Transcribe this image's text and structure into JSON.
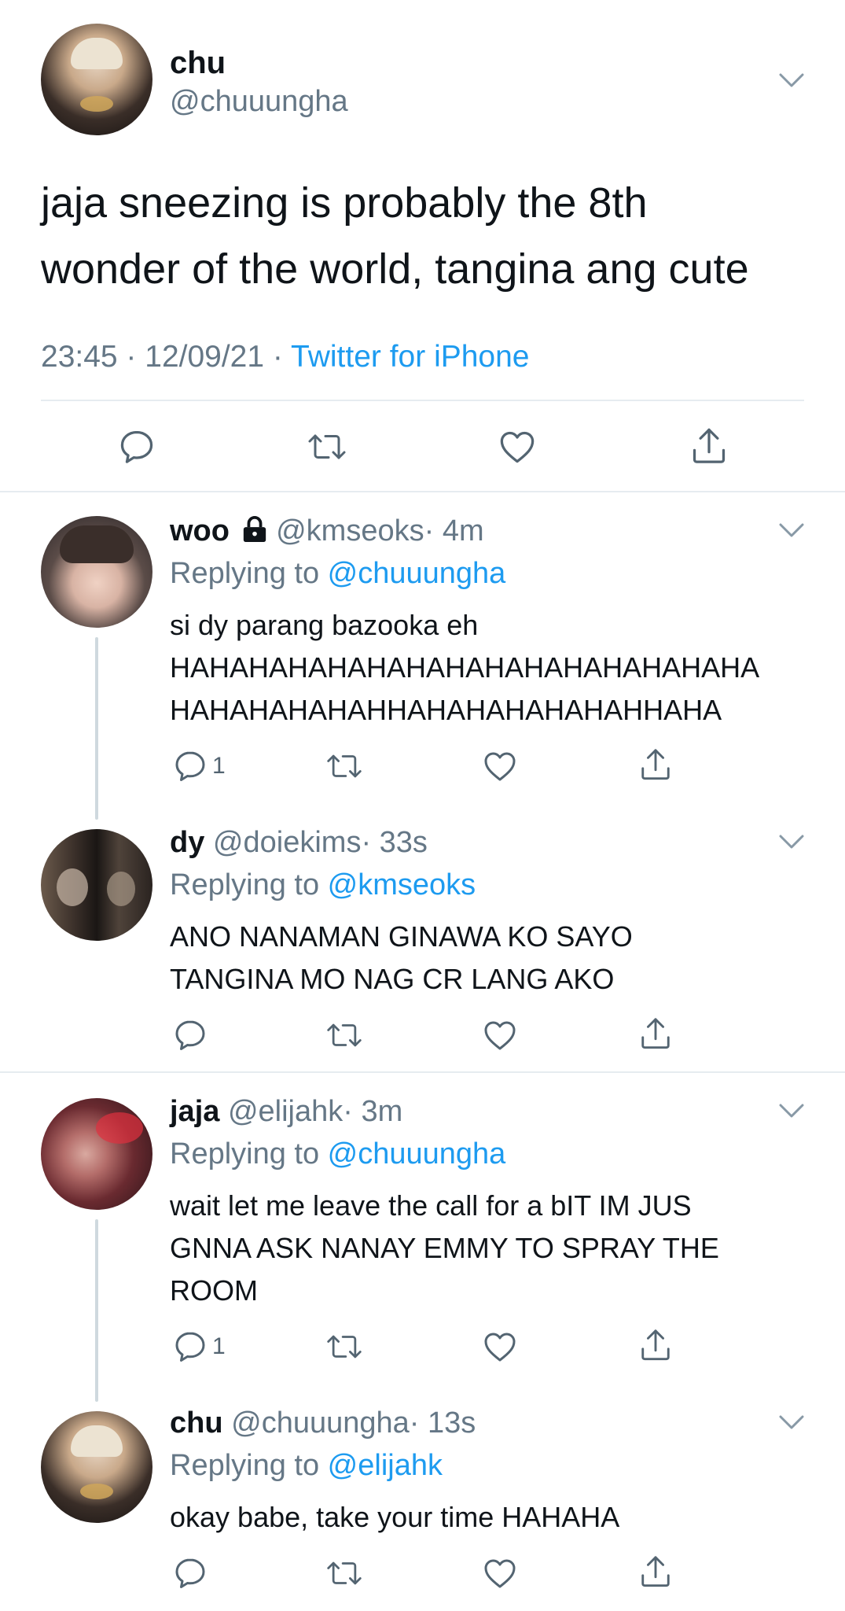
{
  "main_tweet": {
    "display_name": "chu",
    "handle": "@chuuungha",
    "text_line1": "jaja sneezing is probably the 8th",
    "text_line2": "wonder of the world, tangina ang cute",
    "time": "23:45 · 12/09/21 · ",
    "source": "Twitter for iPhone"
  },
  "replying_prefix": "Replying to ",
  "replies": [
    {
      "display_name": "woo",
      "handle": "@kmseoks",
      "age": "· 4m",
      "replying_to": "@chuuungha",
      "lines": [
        "si dy parang bazooka eh",
        "HAHAHAHAHAHAHAHAHAHAHAHAHAHAHA",
        "HAHAHAHAHAHHAHAHAHAHAHAHHAHA"
      ],
      "reply_count": "1"
    },
    {
      "display_name": "dy",
      "handle": "@doiekims",
      "age": "· 33s",
      "replying_to": "@kmseoks",
      "lines": [
        "ANO NANAMAN GINAWA KO SAYO",
        "TANGINA MO NAG CR LANG AKO"
      ],
      "reply_count": ""
    },
    {
      "display_name": "jaja",
      "handle": "@elijahk",
      "age": "· 3m",
      "replying_to": "@chuuungha",
      "lines": [
        "wait let me leave the call for a bIT IM JUS",
        "GNNA ASK NANAY EMMY TO SPRAY THE",
        "ROOM"
      ],
      "reply_count": "1"
    },
    {
      "display_name": "chu",
      "handle": "@chuuungha",
      "age": "· 13s",
      "replying_to": "@elijahk",
      "lines": [
        "okay babe, take your time HAHAHA"
      ],
      "reply_count": ""
    }
  ],
  "icons": [
    "reply-icon",
    "retweet-icon",
    "like-icon",
    "share-icon",
    "chevron-down-icon",
    "lock-icon"
  ],
  "colors": {
    "link": "#1d9bf0",
    "secondary": "#657786",
    "divider": "#e6ecf0",
    "thread_line": "#cfd9de"
  }
}
